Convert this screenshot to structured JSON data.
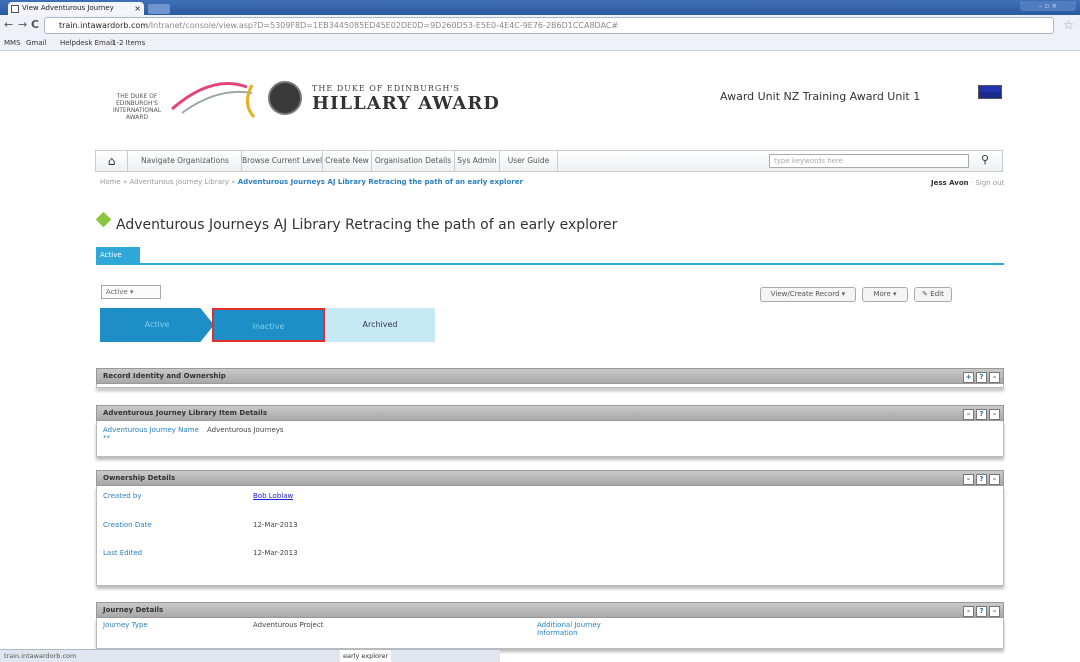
{
  "browser": {
    "tab_title": "View Adventurous Journey",
    "url_domain": "train.intawardorb.com",
    "url_rest": "/Intranet/console/view.asp?D=5309F8D=1EB3445085ED45E02DE0D=9D260D53-E5E0-4E4C-9E76-2B6D1CCA8DAC#",
    "bookmarks": [
      "MMS",
      "Gmail",
      "Helpdesk Email",
      "1-2 Items"
    ]
  },
  "header": {
    "org_logo_text": "THE DUKE OF EDINBURGH'S INTERNATIONAL AWARD",
    "brand_small": "THE DUKE OF EDINBURGH'S",
    "brand_big": "HILLARY AWARD",
    "unit_name": "Award Unit NZ Training Award Unit 1"
  },
  "nav": {
    "items": [
      "Navigate Organizations",
      "Browse Current Level",
      "Create New",
      "Organisation Details",
      "Sys Admin",
      "User Guide"
    ],
    "search_placeholder": "type keywords here"
  },
  "breadcrumb": {
    "path": "Home » Adventurous Journey Library » ",
    "current": "Adventurous Journeys AJ Library Retracing the path of an early explorer"
  },
  "user": {
    "name": "Jess Avon",
    "sign_out": "Sign out"
  },
  "page": {
    "title": "Adventurous Journeys AJ Library Retracing the path of an early explorer",
    "state_tab": "Active",
    "state_dropdown": "Active",
    "view_create_record": "View/Create Record",
    "more": "More",
    "edit": "Edit"
  },
  "workflow": {
    "steps": [
      "Active",
      "Inactive",
      "Archived"
    ]
  },
  "panels": {
    "record_identity": {
      "title": "Record Identity and Ownership"
    },
    "library_item": {
      "title": "Adventurous Journey Library Item Details",
      "name_label": "Adventurous Journey Name",
      "name_required": "**",
      "name_value": "Adventurous Journeys"
    },
    "ownership": {
      "title": "Ownership Details",
      "created_by_label": "Created by",
      "created_by_value": "Bob Loblaw",
      "creation_date_label": "Creation Date",
      "creation_date_value": "12-Mar-2013",
      "last_edited_label": "Last Edited",
      "last_edited_value": "12-Mar-2013"
    },
    "journey": {
      "title": "Journey Details",
      "type_label": "Journey Type",
      "type_value": "Adventurous Project",
      "additional_label": "Additional Journey Information"
    }
  },
  "status_bar": {
    "tail": "early explorer"
  }
}
